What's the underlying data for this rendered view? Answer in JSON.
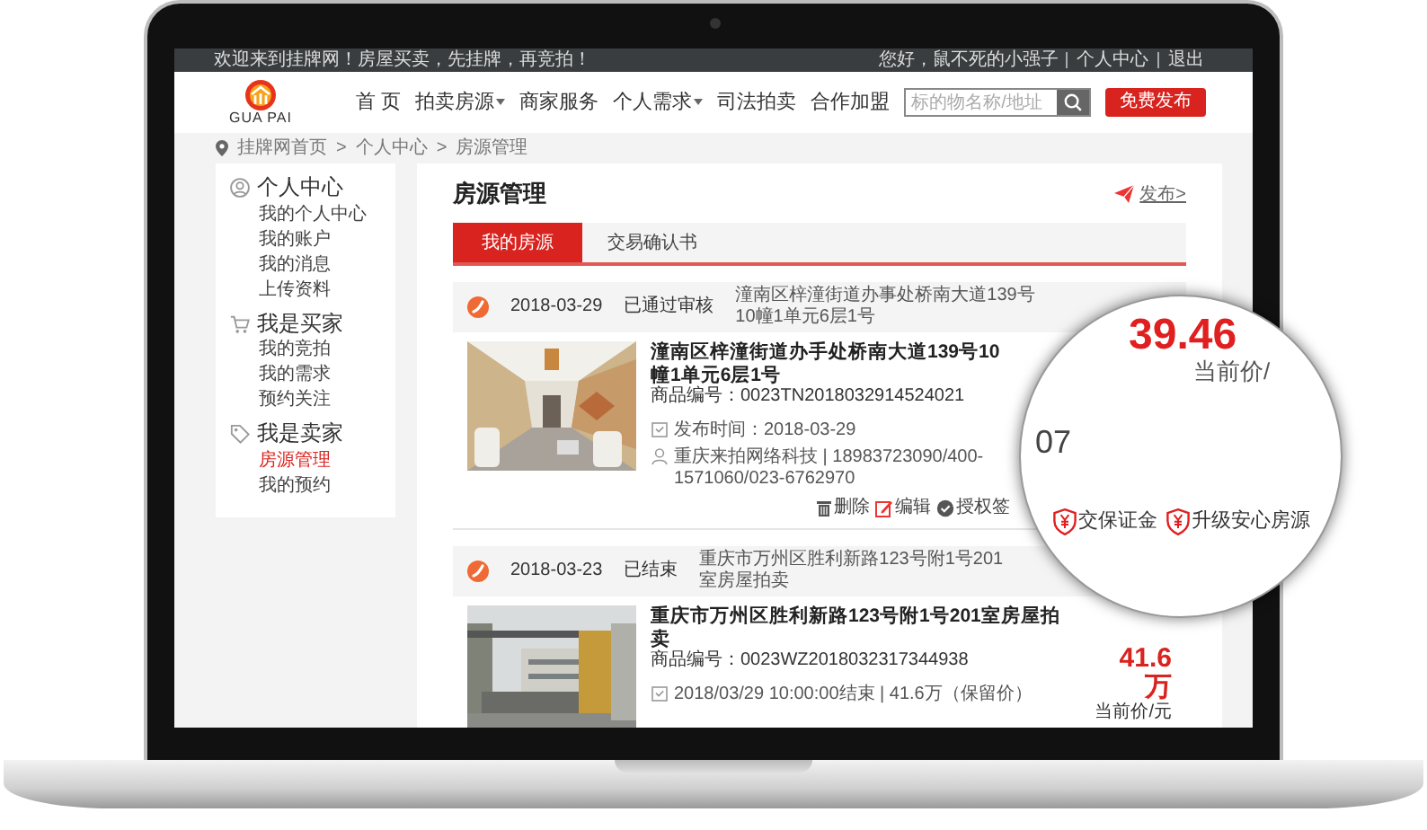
{
  "top_bar": {
    "welcome": "欢迎来到挂牌网！房屋买卖，先挂牌，再竞拍！",
    "greeting": "您好，鼠不死的小强子",
    "links": [
      "个人中心",
      "退出"
    ]
  },
  "header": {
    "logo_text": "GUA PAI",
    "nav": [
      {
        "label": "首 页",
        "dropdown": false
      },
      {
        "label": "拍卖房源",
        "dropdown": true
      },
      {
        "label": "商家服务",
        "dropdown": false
      },
      {
        "label": "个人需求",
        "dropdown": true
      },
      {
        "label": "司法拍卖",
        "dropdown": false
      },
      {
        "label": "合作加盟",
        "dropdown": false
      }
    ],
    "search": {
      "placeholder": "标的物名称/地址"
    },
    "publish_button": "免费发布"
  },
  "breadcrumb": {
    "separator": ">",
    "items": [
      "挂牌网首页",
      "个人中心",
      "房源管理"
    ]
  },
  "sidebar": [
    {
      "kind": "person",
      "title": "个人中心",
      "items": [
        {
          "label": "我的个人中心",
          "selected": false
        },
        {
          "label": "我的账户",
          "selected": false
        },
        {
          "label": "我的消息",
          "selected": false
        },
        {
          "label": "上传资料",
          "selected": false
        }
      ]
    },
    {
      "kind": "cart",
      "title": "我是买家",
      "items": [
        {
          "label": "我的竞拍",
          "selected": false
        },
        {
          "label": "我的需求",
          "selected": false
        },
        {
          "label": "预约关注",
          "selected": false
        }
      ]
    },
    {
      "kind": "tag",
      "title": "我是卖家",
      "items": [
        {
          "label": "房源管理",
          "selected": true
        },
        {
          "label": "我的预约",
          "selected": false
        }
      ]
    }
  ],
  "main": {
    "title": "房源管理",
    "publish_link": "发布>",
    "tabs": [
      {
        "label": "我的房源",
        "selected": true
      },
      {
        "label": "交易确认书",
        "selected": false
      }
    ],
    "listings": [
      {
        "kind": "interior",
        "date": "2018-03-29",
        "status": "已通过审核",
        "address": "潼南区梓潼街道办事处桥南大道139号10幢1单元6层1号",
        "title": "潼南区梓潼街道办手处桥南大道139号10幢1单元6层1号",
        "code": "商品编号：0023TN2018032914524021",
        "meta": [
          {
            "kind": "calendar",
            "text": "发布时间：2018-03-29"
          },
          {
            "kind": "person",
            "text": "重庆来拍网络科技 | 18983723090/400-1571060/023-6762970"
          }
        ],
        "actions": [
          {
            "kind": "delete",
            "label": "删除"
          },
          {
            "kind": "edit",
            "label": "编辑"
          },
          {
            "kind": "authorize",
            "label": "授权签"
          }
        ]
      },
      {
        "kind": "gate",
        "date": "2018-03-23",
        "status": "已结束",
        "address": "重庆市万州区胜利新路123号附1号201室房屋拍卖",
        "title": "重庆市万州区胜利新路123号附1号201室房屋拍卖",
        "code": "商品编号：0023WZ2018032317344938",
        "meta": [
          {
            "kind": "calendar",
            "text": "2018/03/29 10:00:00结束 | 41.6万（保留价）"
          }
        ],
        "price": "41.6 万",
        "price_label": "当前价/元"
      }
    ]
  },
  "magnifier": {
    "price": "39.46",
    "price_label": "当前价/",
    "fragment": "07",
    "badges": [
      "交保证金",
      "升级安心房源"
    ]
  }
}
